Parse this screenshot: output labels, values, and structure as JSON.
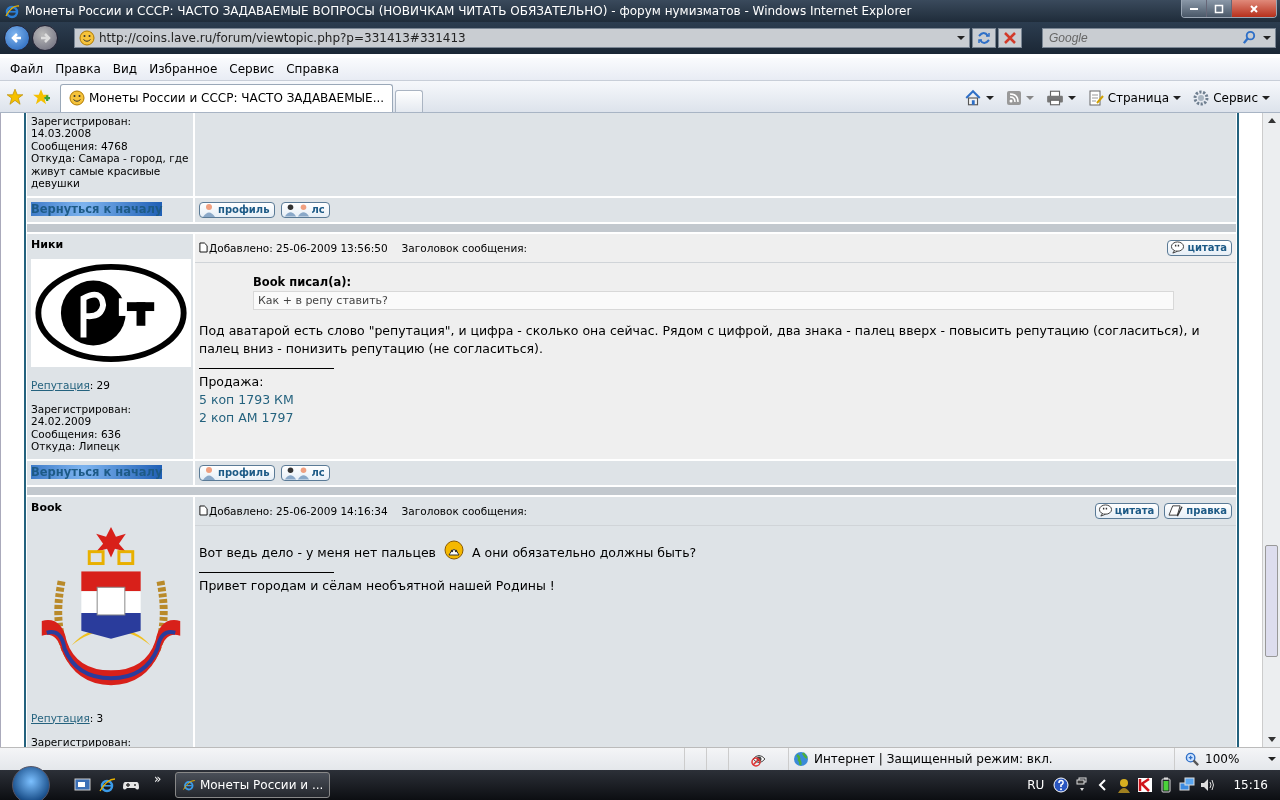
{
  "window": {
    "title": "Монеты России и СССР: ЧАСТО ЗАДАВАЕМЫЕ ВОПРОСЫ (НОВИЧКАМ ЧИТАТЬ ОБЯЗАТЕЛЬНО) - форум нумизматов - Windows Internet Explorer"
  },
  "address": {
    "url": "http://coins.lave.ru/forum/viewtopic.php?p=331413#331413"
  },
  "search": {
    "placeholder": "Google"
  },
  "menu": [
    "Файл",
    "Правка",
    "Вид",
    "Избранное",
    "Сервис",
    "Справка"
  ],
  "tabs": [
    {
      "label": "Монеты России и СССР: ЧАСТО ЗАДАВАЕМЫЕ...",
      "selected": true
    }
  ],
  "toolbar": {
    "page": "Страница",
    "tools": "Сервис"
  },
  "posts": [
    {
      "info": [
        "Зарегистрирован:",
        "14.03.2008",
        "Сообщения: 4768",
        "Откуда: Самара - город, где живут самые красивые девушки"
      ],
      "back_link": "Вернуться к началу",
      "buttons": [
        {
          "kind": "profile",
          "label": "профиль"
        },
        {
          "kind": "pm",
          "label": "лс"
        }
      ]
    },
    {
      "author": "Ники",
      "avatar": {
        "kind": "rst-logo"
      },
      "reputation_label": "Репутация",
      "reputation": ": 29",
      "info": [
        "Зарегистрирован:",
        "24.02.2009",
        "Сообщения: 636",
        "Откуда: Липецк"
      ],
      "added": "Добавлено: 25-06-2009 13:56:50",
      "subject_label": "Заголовок сообщения:",
      "actions": [
        {
          "kind": "quote",
          "label": "цитата"
        }
      ],
      "quote": {
        "author": "Book писал(а):",
        "text": "Как + в репу ставить?"
      },
      "body": [
        [
          {
            "kind": "text",
            "text": "Под аватарой есть слово \"репутация\", и цифра - сколько она сейчас. Рядом с цифрой, два знака - палец вверх - повысить репутацию (согласиться), и палец вниз - понизить репутацию (не согласиться)."
          }
        ]
      ],
      "signature": [
        {
          "kind": "text",
          "text": "Продажа:"
        },
        {
          "kind": "link",
          "text": "5 коп 1793 КМ"
        },
        {
          "kind": "link",
          "text": "2 коп АМ 1797"
        }
      ],
      "back_link": "Вернуться к началу",
      "buttons": [
        {
          "kind": "profile",
          "label": "профиль"
        },
        {
          "kind": "pm",
          "label": "лс"
        }
      ]
    },
    {
      "author": "Book",
      "avatar": {
        "kind": "coat-of-arms"
      },
      "reputation_label": "Репутация",
      "reputation": ": 3",
      "info": [
        "Зарегистрирован:"
      ],
      "added": "Добавлено: 25-06-2009 14:16:34",
      "subject_label": "Заголовок сообщения:",
      "actions": [
        {
          "kind": "quote",
          "label": "цитата"
        },
        {
          "kind": "edit",
          "label": "правка"
        }
      ],
      "body": [
        [
          {
            "kind": "text",
            "text": "Вот ведь дело - у меня нет пальцев"
          },
          {
            "kind": "smiley"
          },
          {
            "kind": "text",
            "text": "А они обязательно должны быть?"
          }
        ]
      ],
      "signature": [
        {
          "kind": "text",
          "text": "Привет городам и сёлам необъятной нашей Родины !"
        }
      ]
    }
  ],
  "status_bar": {
    "zone": "Интернет | Защищенный режим: вкл.",
    "zoom": "100%"
  },
  "taskbar": {
    "overflow": "»",
    "tasks": [
      {
        "label": "Монеты России и ...",
        "selected": true
      }
    ],
    "language": "RU",
    "clock": "15:16"
  }
}
